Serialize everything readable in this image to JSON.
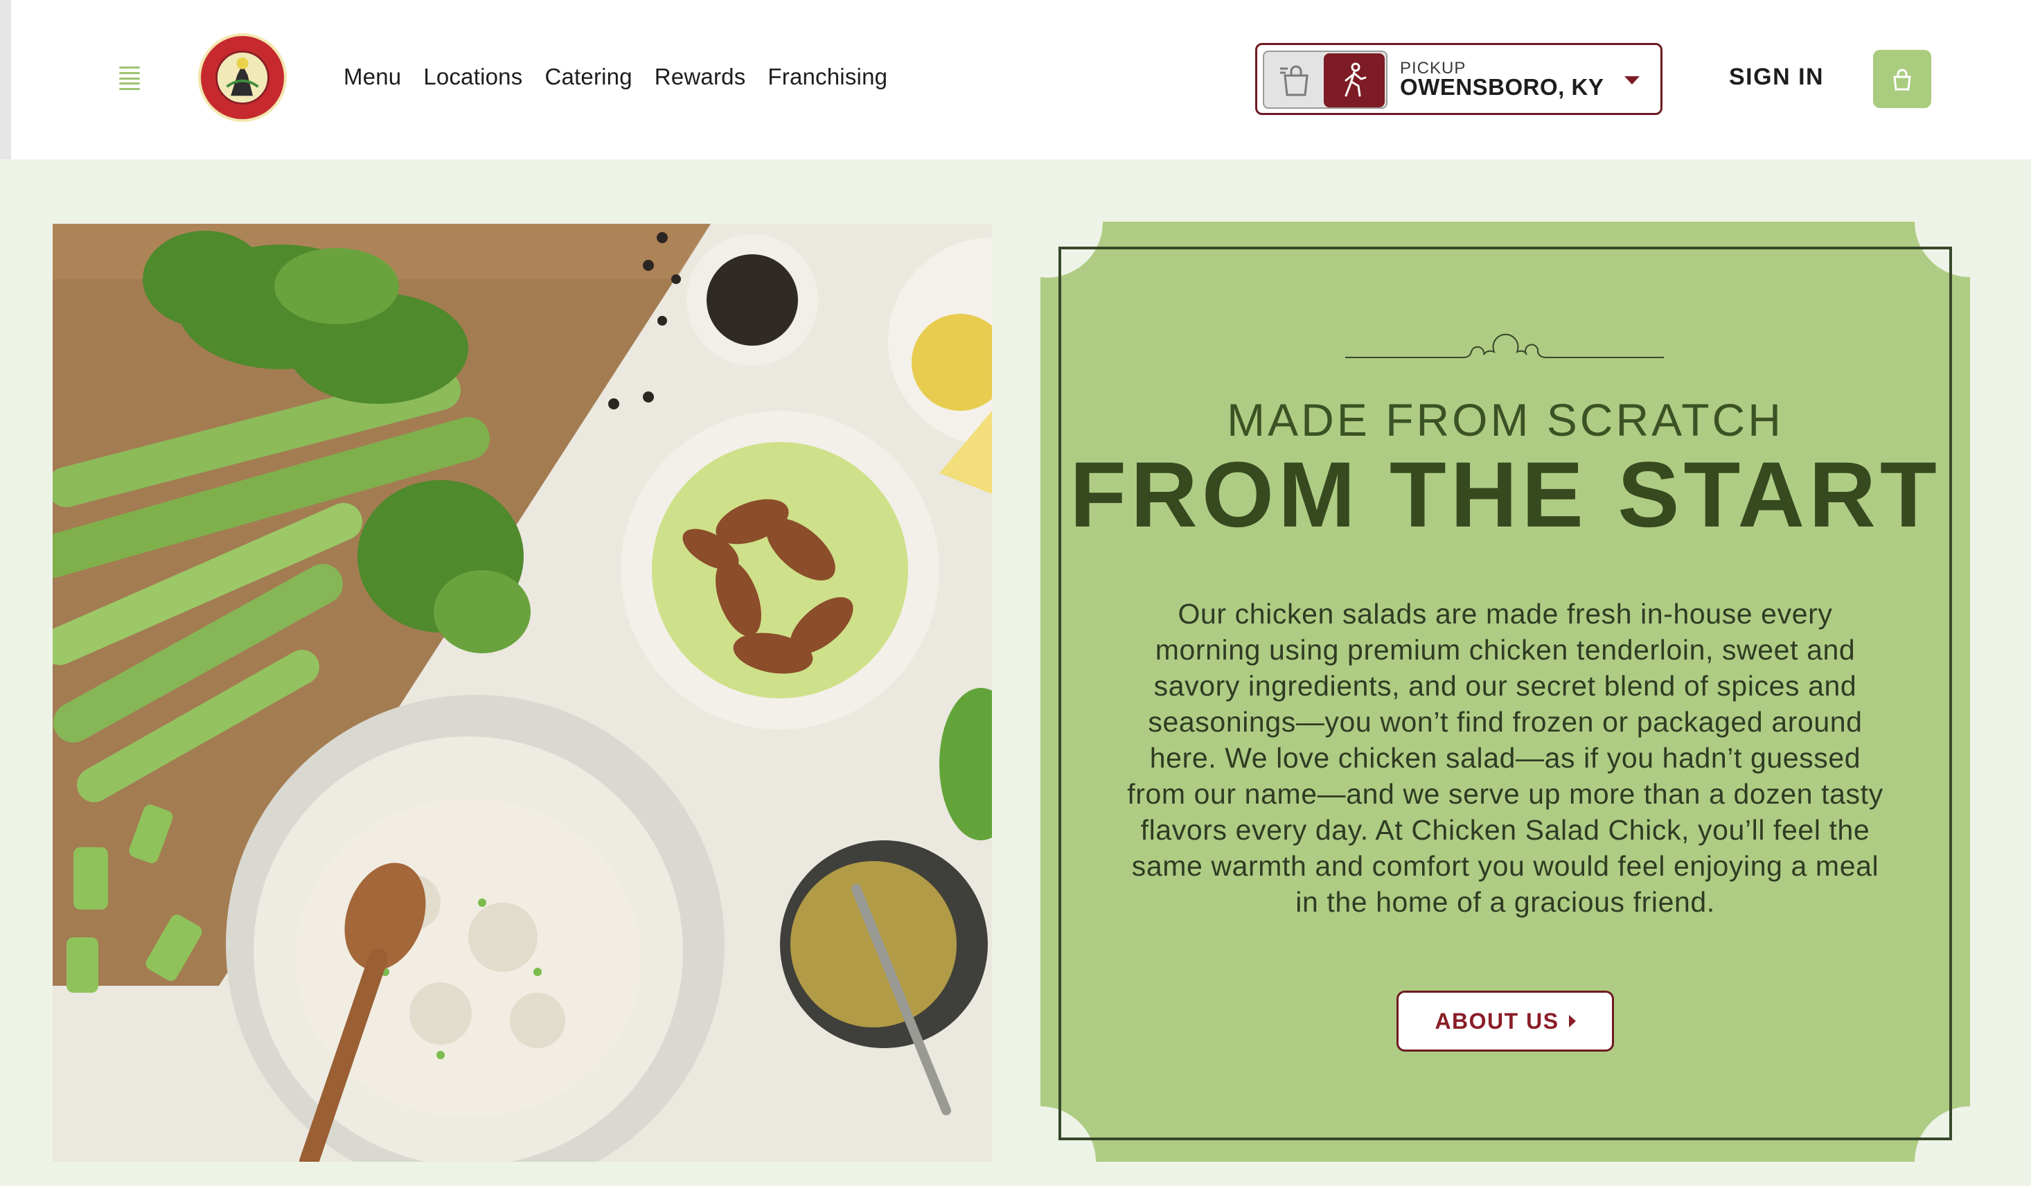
{
  "header": {
    "logo_text": "CHICKEN SALAD CHICK",
    "nav": [
      "Menu",
      "Locations",
      "Catering",
      "Rewards",
      "Franchising"
    ],
    "order": {
      "mode_label": "PICKUP",
      "location": "OWENSBORO, KY"
    },
    "sign_in": "SIGN IN"
  },
  "hero": {
    "kicker": "MADE FROM SCRATCH",
    "headline": "FROM THE START",
    "body": "Our chicken salads are made fresh in-house every morning using premium chicken tenderloin, sweet and savory ingredients, and our secret blend of spices and seasonings—you won’t find frozen or packaged around here. We love chicken salad—as if you hadn’t guessed from our name—and we serve up more than a dozen tasty flavors every day. At Chicken Salad Chick, you’ll feel the same warmth and comfort you would feel enjoying a meal in the home of a gracious friend.",
    "cta": "ABOUT US"
  },
  "colors": {
    "brand_red": "#7d1c24",
    "card_green": "#afcc84",
    "accent_green": "#a9cc7e",
    "headline_green": "#36491f",
    "page_bg": "#eef3e7"
  },
  "icons": [
    "menu-icon",
    "bag-icon",
    "walking-person-icon",
    "chevron-down-icon",
    "lock-bag-icon",
    "chevron-right-icon"
  ]
}
